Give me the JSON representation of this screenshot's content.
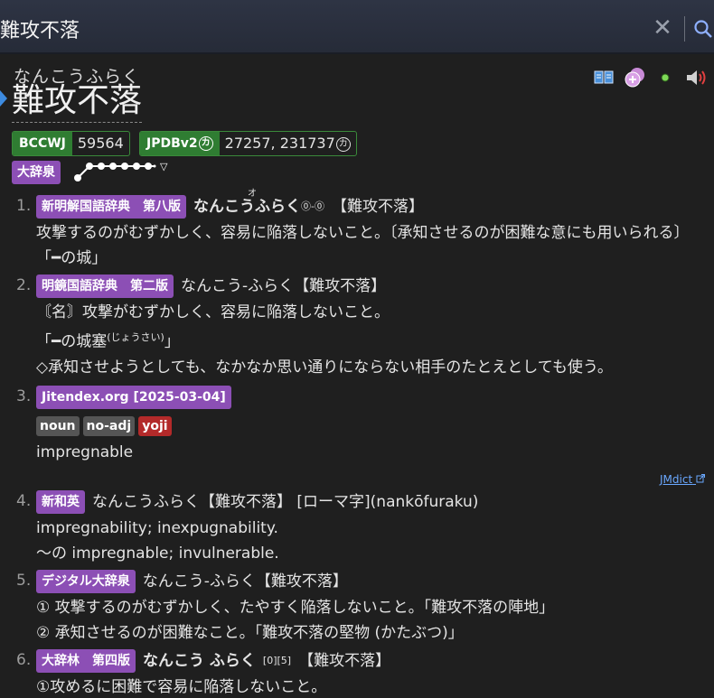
{
  "search": {
    "value": "難攻不落",
    "placeholder": ""
  },
  "header": {
    "reading": "なんこうふらく",
    "term": "難攻不落"
  },
  "action_icons": [
    "dictionary-icon",
    "add-note-icon",
    "status-dot-icon",
    "audio-icon"
  ],
  "frequencies": [
    {
      "name": "BCCWJ",
      "value": "59564"
    },
    {
      "name": "JPDBv2",
      "circled": "カ",
      "value": "27257, 231737",
      "value_circled": "カ"
    }
  ],
  "pitch": {
    "dict": "大辞泉",
    "arrow_label": "▽"
  },
  "definitions": [
    {
      "num": "1.",
      "source": "新明解国語辞典　第八版",
      "headword_bold": "なんこうふらく",
      "ruby": "オ",
      "accent": "⓪-⓪",
      "kanji": "【難攻不落】",
      "lines": [
        "攻撃するのがむずかしく、容易に陥落しないこと。〔承知させるのが困難な意にも用いられる〕",
        "「━の城」"
      ]
    },
    {
      "num": "2.",
      "source": "明鏡国語辞典　第二版",
      "headword": "なんこう-ふらく【難攻不落】",
      "lines": [
        "〘名〙攻撃がむずかしく、容易に陥落しないこと。",
        "「━の城塞",
        "◇承知させようとしても、なかなか思い通りにならない相手のたとえとしても使う。"
      ],
      "ruby_line2": "(じょうさい)",
      "close_line2": "」"
    },
    {
      "num": "3.",
      "source": "Jitendex.org [2025-03-04]",
      "tags": [
        "noun",
        "no-adj",
        "yoji"
      ],
      "lines": [
        "impregnable"
      ],
      "link": "JMdict"
    },
    {
      "num": "4.",
      "source": "新和英",
      "headword": "なんこうふらく【難攻不落】 [ローマ字](nankōfuraku)",
      "lines": [
        "impregnability; inexpugnability.",
        "〜の impregnable; invulnerable."
      ]
    },
    {
      "num": "5.",
      "source": "デジタル大辞泉",
      "headword": "なんこう-ふらく【難攻不落】",
      "lines": [
        "① 攻撃するのがむずかしく、たやすく陥落しないこと。「難攻不落の陣地」",
        "② 承知させるのが困難なこと。「難攻不落の堅物 (かたぶつ)」"
      ]
    },
    {
      "num": "6.",
      "source": "大辞林　第四版",
      "headword_bold": "なんこう ふらく",
      "accent": "[0][5]",
      "kanji": "【難攻不落】",
      "lines": [
        "①攻めるに困難で容易に陥落しないこと。"
      ]
    }
  ],
  "colors": {
    "accent": "#3d8be0",
    "source_tag": "#8c4fb5",
    "freq_tag": "#2f7d32",
    "link": "#6aa8ff"
  }
}
